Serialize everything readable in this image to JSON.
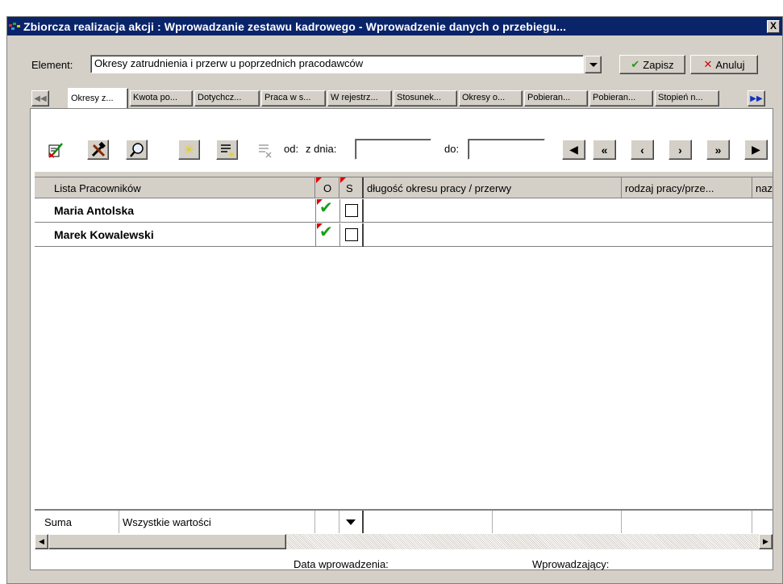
{
  "window": {
    "title": "Zbiorcza realizacja akcji :  Wprowadzanie zestawu kadrowego - Wprowadzenie danych o przebiegu...",
    "close_label": "X"
  },
  "element": {
    "label": "Element:",
    "value": "Okresy zatrudnienia i przerw u poprzednich pracodawców"
  },
  "actions": {
    "save_label": "Zapisz",
    "cancel_label": "Anuluj"
  },
  "tabs": [
    {
      "label": "Okresy z...",
      "active": true
    },
    {
      "label": "Kwota po...",
      "active": false
    },
    {
      "label": "Dotychcz...",
      "active": false
    },
    {
      "label": "Praca w s...",
      "active": false
    },
    {
      "label": "W rejestrz...",
      "active": false
    },
    {
      "label": "Stosunek...",
      "active": false
    },
    {
      "label": "Okresy o...",
      "active": false
    },
    {
      "label": "Pobieran...",
      "active": false
    },
    {
      "label": "Pobieran...",
      "active": false
    },
    {
      "label": "Stopień n...",
      "active": false
    }
  ],
  "filters": {
    "from_label": "od:",
    "from_date_label": "z dnia:",
    "from_value": "",
    "to_label": "do:",
    "to_value": ""
  },
  "grid": {
    "columns": {
      "name": "Lista Pracowników",
      "o": "O",
      "s": "S",
      "col1": "długość okresu pracy / przerwy",
      "col2": "rodzaj pracy/prze...",
      "col3": "naz"
    },
    "rows": [
      {
        "name": "Maria Antolska",
        "o": true,
        "s": false
      },
      {
        "name": "Marek Kowalewski",
        "o": true,
        "s": false
      }
    ]
  },
  "footer": {
    "sum_label": "Suma",
    "filter_value": "Wszystkie wartości"
  },
  "meta": {
    "entry_date_label": "Data wprowadzenia:",
    "entered_by_label": "Wprowadzający:"
  },
  "colors": {
    "titlebar": "#0a246a",
    "face": "#d4d0c8",
    "check_green": "#18a018",
    "flag_red": "#e00000"
  }
}
